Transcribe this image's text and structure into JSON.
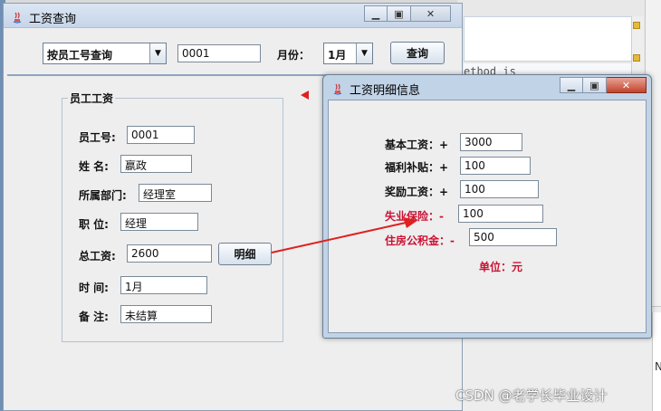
{
  "background": {
    "code_fragment": "ethod is",
    "right_panel_letter": "N"
  },
  "main_window": {
    "title": "工资查询",
    "query_mode": "按员工号查询",
    "employee_id_value": "0001",
    "month_label": "月份：",
    "month_value": "1月",
    "query_button": "查询",
    "group_title": "员工工资",
    "fields": {
      "emp_id": {
        "label": "员工号:",
        "value": "0001"
      },
      "name": {
        "label": "姓  名:",
        "value": "嬴政"
      },
      "department": {
        "label": "所属部门:",
        "value": "经理室"
      },
      "position": {
        "label": "职  位:",
        "value": "经理"
      },
      "total_salary": {
        "label": "总工资:",
        "value": "2600"
      },
      "time": {
        "label": "时  间:",
        "value": "1月"
      },
      "remark": {
        "label": "备  注:",
        "value": "未结算"
      }
    },
    "detail_button": "明细"
  },
  "detail_window": {
    "title": "工资明细信息",
    "rows": {
      "base": {
        "label": "基本工资：+",
        "value": "3000"
      },
      "welfare": {
        "label": "福利补贴：+",
        "value": "100"
      },
      "bonus": {
        "label": "奖励工资：+",
        "value": "100"
      },
      "unemployment": {
        "label": "失业保险：-",
        "value": "100"
      },
      "housing_fund": {
        "label": "住房公积金：-",
        "value": "500"
      }
    },
    "unit_text": "单位：元"
  },
  "watermark": "CSDN @老学长毕业设计",
  "colors": {
    "deduction_red": "#cc1133",
    "arrow_red": "#e02020"
  }
}
